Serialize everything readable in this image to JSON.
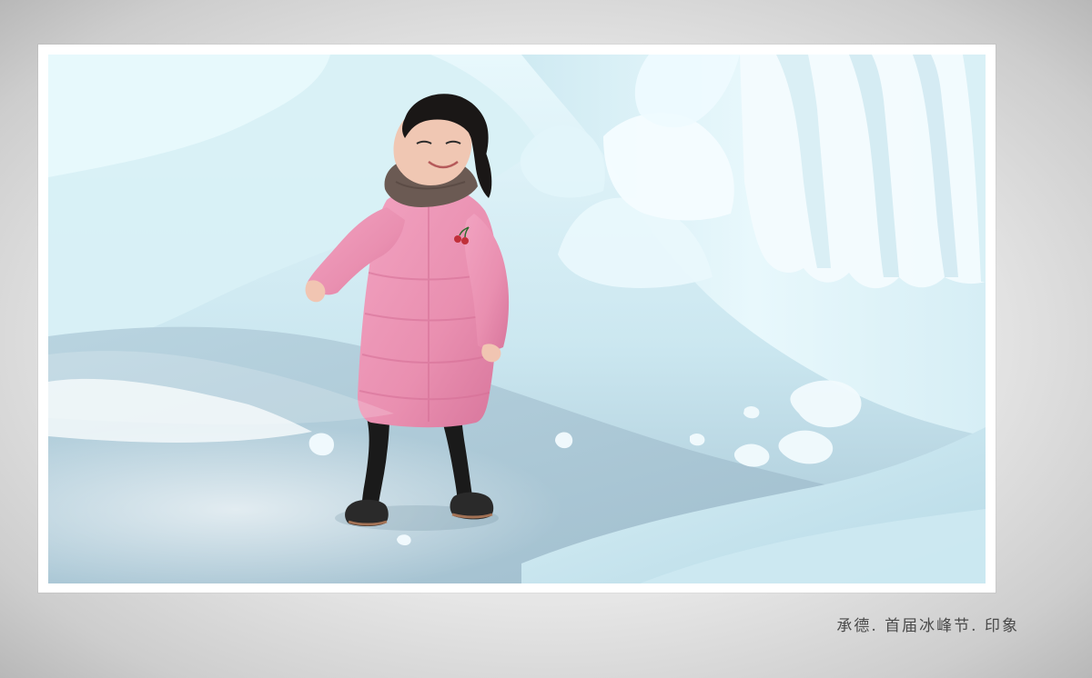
{
  "photo": {
    "caption": "承德. 首届冰峰节. 印象"
  },
  "colors": {
    "jacket_pink": "#e98fb0",
    "ice_light": "#e6f6fb",
    "ice_mid": "#bfe3ee",
    "ice_shadow": "#94bfd0",
    "ground": "#a9c7d7"
  }
}
